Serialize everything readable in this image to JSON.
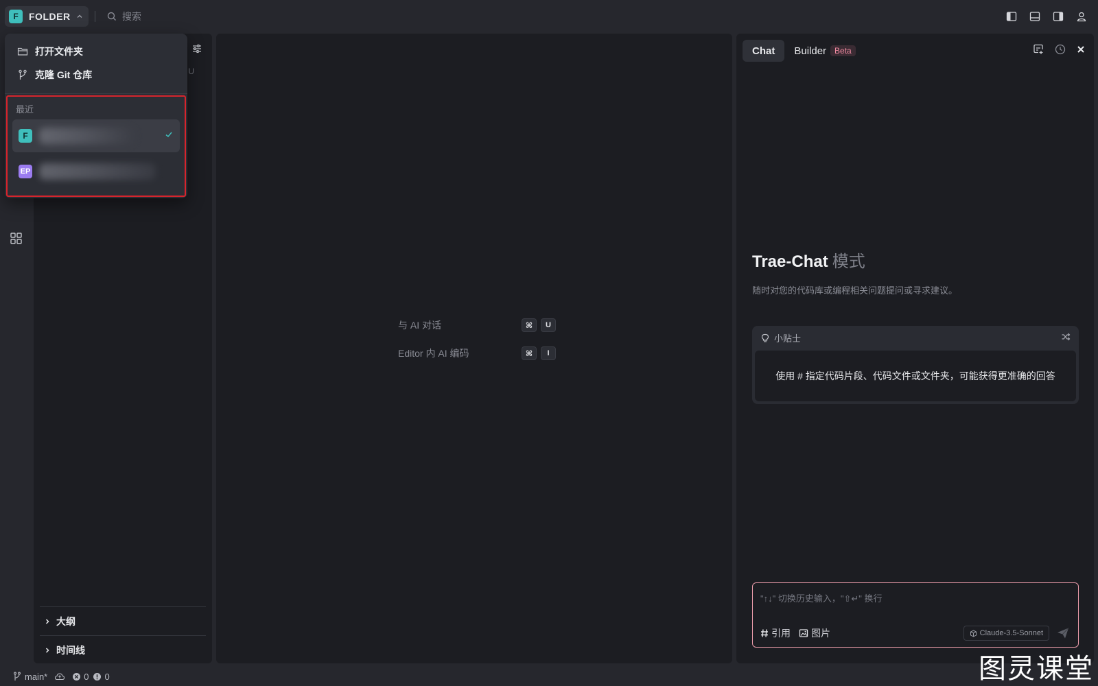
{
  "titlebar": {
    "folder_badge": "F",
    "folder_name": "FOLDER",
    "search_placeholder": "搜索"
  },
  "explorer": {
    "u_marker": "U",
    "sections": [
      {
        "label": "大纲"
      },
      {
        "label": "时间线"
      }
    ]
  },
  "dropdown": {
    "items": [
      {
        "label": "打开文件夹",
        "icon": "folder-open-icon"
      },
      {
        "label": "克隆 Git 仓库",
        "icon": "git-branch-icon"
      }
    ],
    "recent_label": "最近",
    "recent": [
      {
        "badge": "F",
        "badge_color": "#3fbfbc",
        "selected": true
      },
      {
        "badge": "EP",
        "badge_color": "#9b7cf0",
        "selected": false
      }
    ]
  },
  "editor": {
    "hints": [
      {
        "text": "与 AI 对话",
        "keys": [
          "⌘",
          "U"
        ]
      },
      {
        "text": "Editor 内 AI 编码",
        "keys": [
          "⌘",
          "I"
        ]
      }
    ]
  },
  "chat": {
    "tabs": [
      {
        "label": "Chat",
        "active": true
      },
      {
        "label": "Builder",
        "active": false,
        "badge": "Beta"
      }
    ],
    "mode_title": "Trae-Chat",
    "mode_subtitle": "模式",
    "mode_desc": "随时对您的代码库或编程相关问题提问或寻求建议。",
    "tip_title": "小贴士",
    "tip_text": "使用 # 指定代码片段、代码文件或文件夹，可能获得更准确的回答",
    "input_placeholder": "\"↑↓\" 切换历史输入，\"⇧↵\" 换行",
    "actions": [
      {
        "label": "引用",
        "icon": "hash-icon"
      },
      {
        "label": "图片",
        "icon": "image-icon"
      }
    ],
    "model": "Claude-3.5-Sonnet"
  },
  "statusbar": {
    "branch": "main*",
    "errors": "0",
    "warnings": "0"
  },
  "watermark": "图灵课堂",
  "colors": {
    "background": "#26272d",
    "panel": "#1c1d22",
    "highlight_border": "#d7242c",
    "input_border": "#e89aa8",
    "beta": "#f08aa1"
  }
}
